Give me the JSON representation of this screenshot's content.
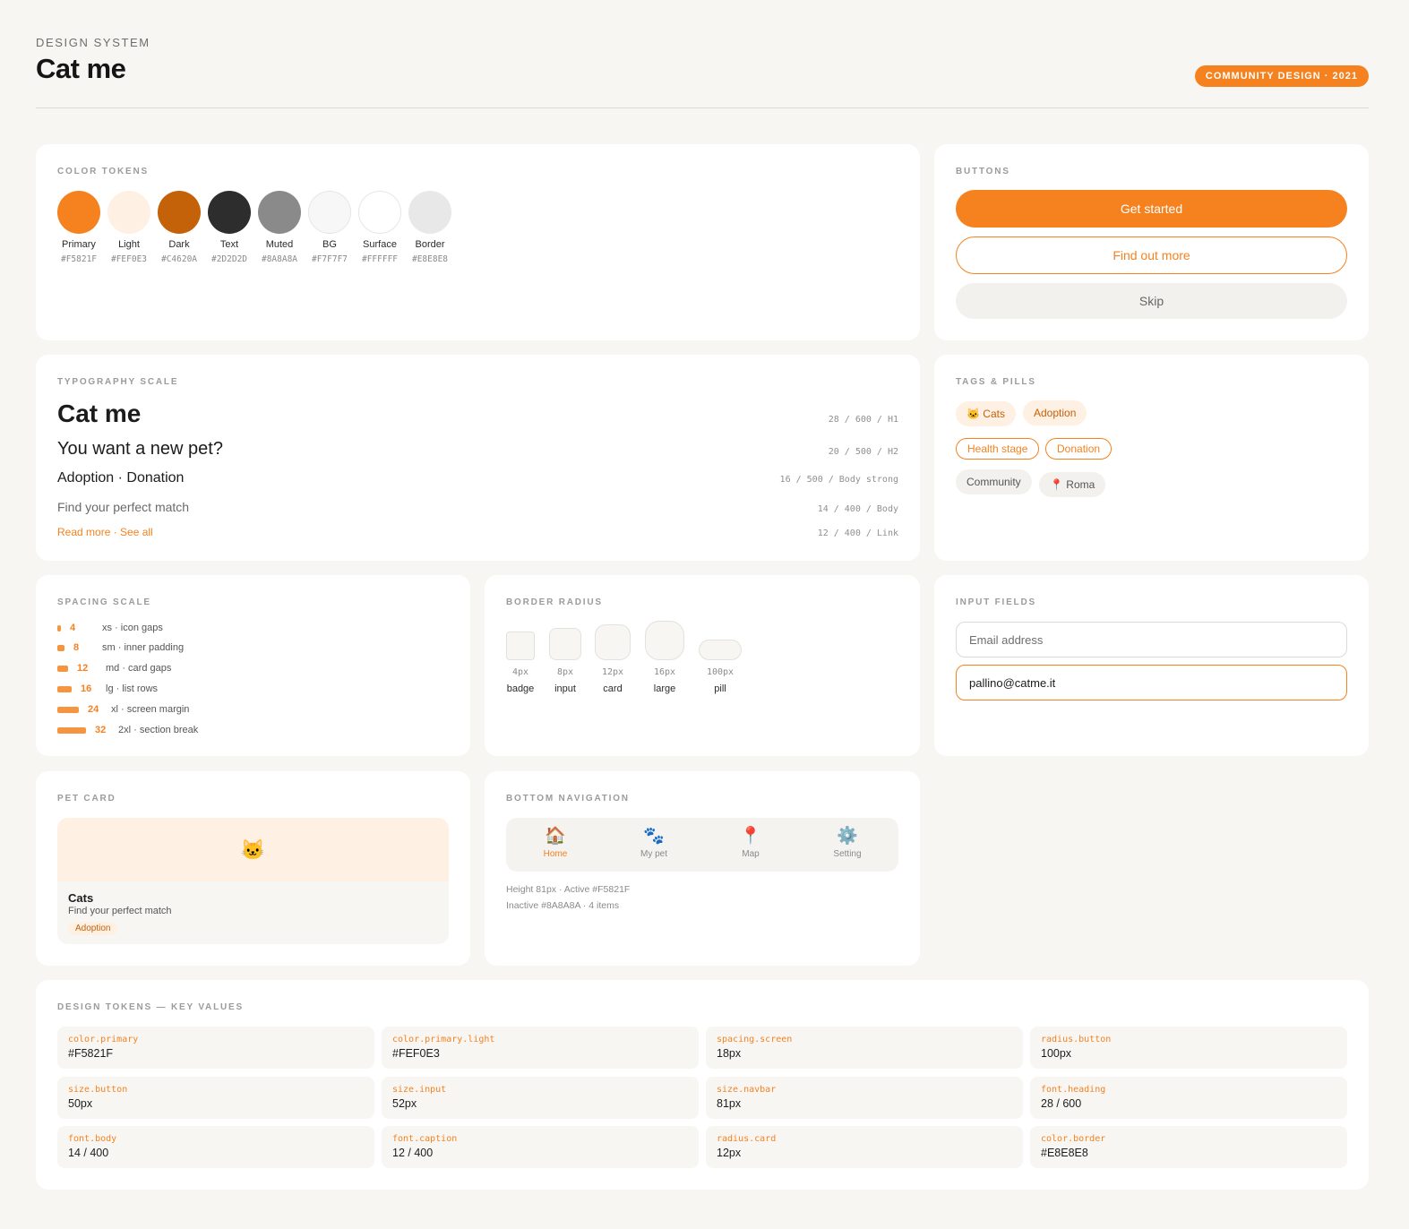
{
  "header": {
    "eyebrow": "DESIGN SYSTEM",
    "title": "Cat me",
    "badge": "COMMUNITY DESIGN · 2021"
  },
  "colors": {
    "title": "COLOR TOKENS",
    "items": [
      {
        "name": "Primary",
        "hex": "#F5821F",
        "color": "#F5821F"
      },
      {
        "name": "Light",
        "hex": "#FEF0E3",
        "color": "#FEF0E3"
      },
      {
        "name": "Dark",
        "hex": "#C4620A",
        "color": "#C4620A"
      },
      {
        "name": "Text",
        "hex": "#2D2D2D",
        "color": "#2D2D2D"
      },
      {
        "name": "Muted",
        "hex": "#8A8A8A",
        "color": "#8A8A8A"
      },
      {
        "name": "BG",
        "hex": "#F7F7F7",
        "color": "#F7F7F7"
      },
      {
        "name": "Surface",
        "hex": "#FFFFFF",
        "color": "#FFFFFF"
      },
      {
        "name": "Border",
        "hex": "#E8E8E8",
        "color": "#E8E8E8"
      }
    ]
  },
  "buttons": {
    "title": "BUTTONS",
    "primary": "Get started",
    "outline": "Find out more",
    "ghost": "Skip"
  },
  "typography": {
    "title": "TYPOGRAPHY SCALE",
    "h1": {
      "text": "Cat me",
      "meta": "28 / 600 / H1"
    },
    "h2": {
      "text": "You want a new pet?",
      "meta": "20 / 500 / H2"
    },
    "strong": {
      "text": "Adoption · Donation",
      "meta": "16 / 500 / Body strong"
    },
    "body": {
      "text": "Find your perfect match",
      "meta": "14 / 400 / Body"
    },
    "link": {
      "text": "Read more · See all",
      "meta": "12 / 400 / Link"
    }
  },
  "tags": {
    "title": "TAGS & PILLS",
    "cats": "🐱 Cats",
    "adoption": "Adoption",
    "health": "Health stage",
    "donation": "Donation",
    "community": "Community",
    "roma": "📍 Roma"
  },
  "spacing": {
    "title": "SPACING SCALE",
    "rows": [
      {
        "value": "4",
        "desc": "xs · icon gaps",
        "size": 4
      },
      {
        "value": "8",
        "desc": "sm · inner padding",
        "size": 8
      },
      {
        "value": "12",
        "desc": "md · card gaps",
        "size": 12
      },
      {
        "value": "16",
        "desc": "lg · list rows",
        "size": 16
      },
      {
        "value": "24",
        "desc": "xl · screen margin",
        "size": 24
      },
      {
        "value": "32",
        "desc": "2xl · section break",
        "size": 32
      }
    ]
  },
  "radius": {
    "title": "BORDER RADIUS",
    "items": [
      {
        "px": "4px",
        "label": "badge"
      },
      {
        "px": "8px",
        "label": "input"
      },
      {
        "px": "12px",
        "label": "card"
      },
      {
        "px": "16px",
        "label": "large"
      },
      {
        "px": "100px",
        "label": "pill"
      }
    ]
  },
  "inputs": {
    "title": "INPUT FIELDS",
    "placeholder": "Email address",
    "value": "pallino@catme.it"
  },
  "petcard": {
    "title": "PET CARD",
    "emoji": "🐱",
    "name": "Cats",
    "desc": "Find your perfect match",
    "tag": "Adoption"
  },
  "bottomnav": {
    "title": "BOTTOM NAVIGATION",
    "items": [
      {
        "icon": "🏠",
        "label": "Home"
      },
      {
        "icon": "🐾",
        "label": "My pet"
      },
      {
        "icon": "📍",
        "label": "Map"
      },
      {
        "icon": "⚙️",
        "label": "Setting"
      }
    ],
    "note1": "Height 81px · Active #F5821F",
    "note2": "Inactive #8A8A8A · 4 items"
  },
  "tokens": {
    "title": "DESIGN TOKENS — KEY VALUES",
    "items": [
      {
        "key": "color.primary",
        "value": "#F5821F"
      },
      {
        "key": "color.primary.light",
        "value": "#FEF0E3"
      },
      {
        "key": "spacing.screen",
        "value": "18px"
      },
      {
        "key": "radius.button",
        "value": "100px"
      },
      {
        "key": "size.button",
        "value": "50px"
      },
      {
        "key": "size.input",
        "value": "52px"
      },
      {
        "key": "size.navbar",
        "value": "81px"
      },
      {
        "key": "font.heading",
        "value": "28 / 600"
      },
      {
        "key": "font.body",
        "value": "14 / 400"
      },
      {
        "key": "font.caption",
        "value": "12 / 400"
      },
      {
        "key": "radius.card",
        "value": "12px"
      },
      {
        "key": "color.border",
        "value": "#E8E8E8"
      }
    ]
  }
}
